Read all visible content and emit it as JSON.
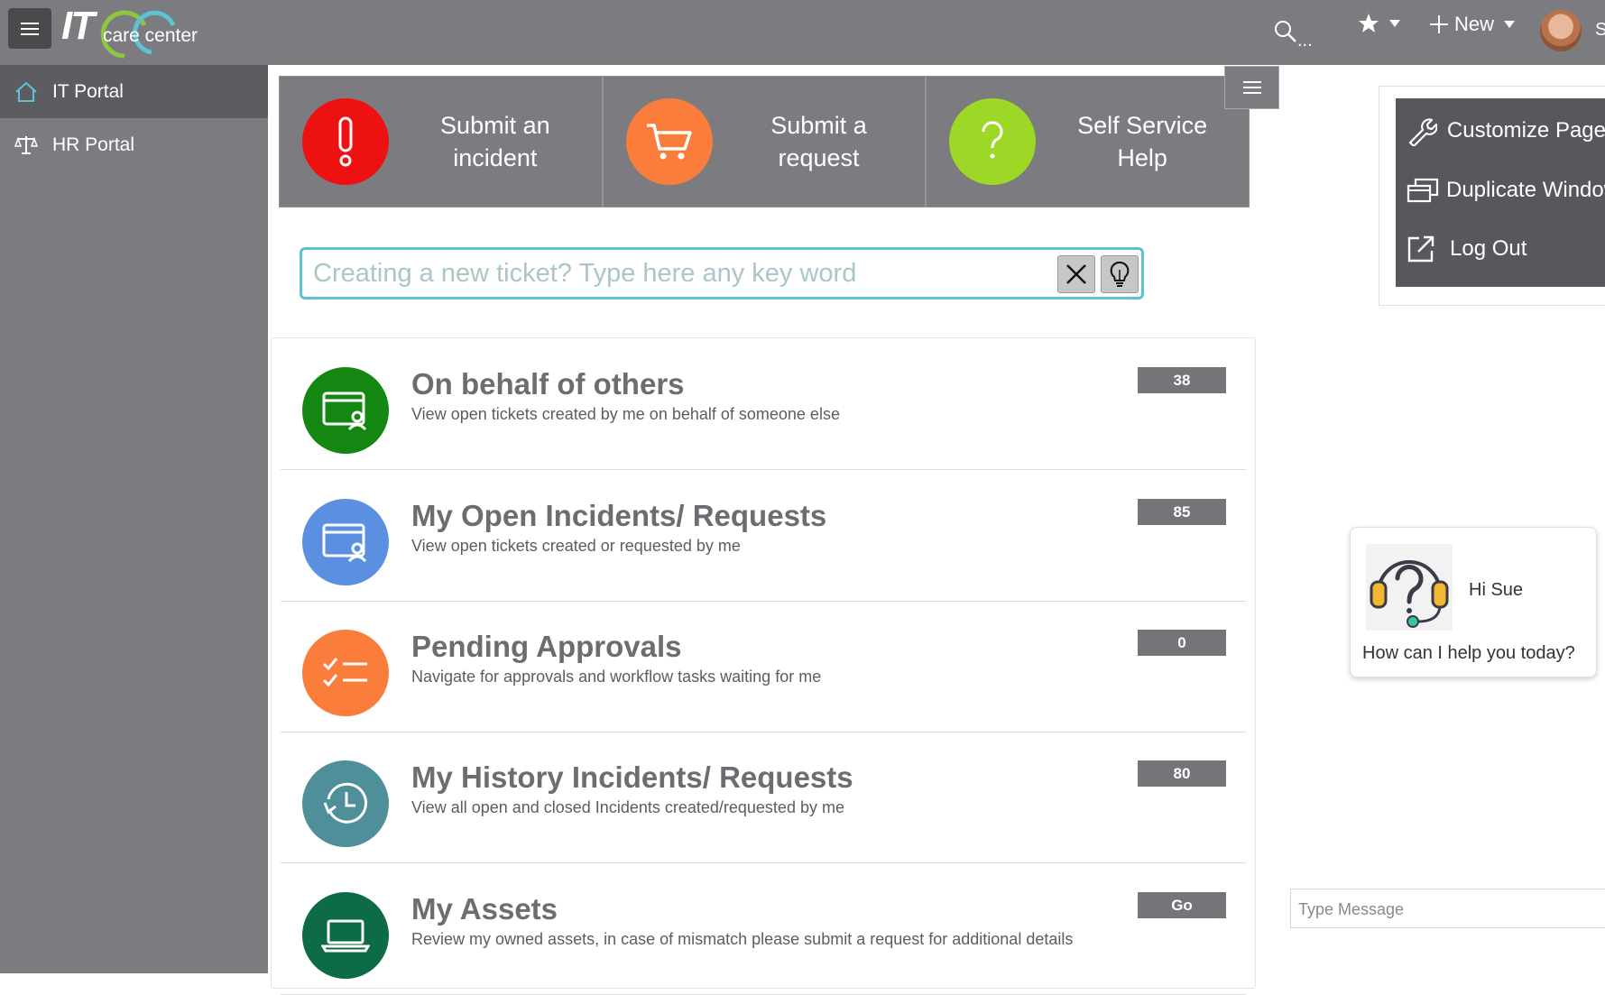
{
  "app": {
    "logo_it": "IT",
    "logo_text": "care center"
  },
  "topbar": {
    "search_more": "...",
    "new_label": "New",
    "user_initial": "S"
  },
  "sidebar": {
    "items": [
      {
        "label": "IT Portal",
        "icon": "home-icon"
      },
      {
        "label": "HR Portal",
        "icon": "scale-icon"
      }
    ]
  },
  "tiles": [
    {
      "label_line1": "Submit an",
      "label_line2": "incident",
      "icon": "exclamation-icon",
      "color": "#ee1111"
    },
    {
      "label_line1": "Submit a",
      "label_line2": "request",
      "icon": "cart-icon",
      "color": "#fb7d3c"
    },
    {
      "label_line1": "Self Service",
      "label_line2": "Help",
      "icon": "question-icon",
      "color": "#9ed827"
    }
  ],
  "search": {
    "placeholder": "Creating a new ticket? Type here any key word"
  },
  "list": [
    {
      "title": "On behalf of others",
      "subtitle": "View open tickets created by me on behalf of someone else",
      "count": "38",
      "color": "#138711",
      "icon": "user-card-icon"
    },
    {
      "title": "My Open Incidents/ Requests",
      "subtitle": "View open tickets created or requested by me",
      "count": "85",
      "color": "#5b8fe0",
      "icon": "user-card-icon"
    },
    {
      "title": "Pending Approvals",
      "subtitle": "Navigate for approvals and workflow tasks waiting for me",
      "count": "0",
      "color": "#fb7d3c",
      "icon": "checklist-icon"
    },
    {
      "title": "My History Incidents/ Requests",
      "subtitle": "View all open and closed Incidents created/requested by me",
      "count": "80",
      "color": "#4e8f99",
      "icon": "history-icon"
    },
    {
      "title": "My Assets",
      "subtitle": "Review my owned assets, in case of mismatch please submit a request for additional details",
      "count": "Go",
      "color": "#0d6b45",
      "icon": "laptop-icon"
    }
  ],
  "dropdown": {
    "items": [
      {
        "label": "Customize Page",
        "icon": "wrench-icon"
      },
      {
        "label": "Duplicate Window",
        "icon": "duplicate-window-icon"
      },
      {
        "label": "Log Out",
        "icon": "external-link-icon"
      }
    ]
  },
  "chat": {
    "greeting": "Hi Sue",
    "question": "How can I help you today?",
    "input_placeholder": "Type Message"
  }
}
